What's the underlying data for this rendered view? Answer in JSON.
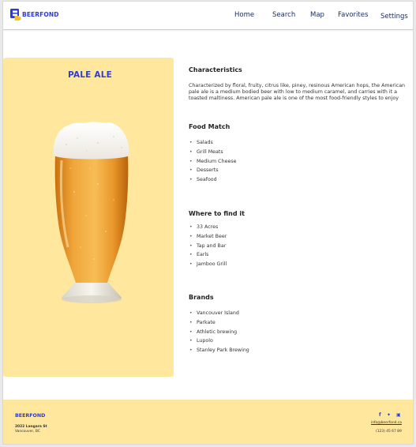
{
  "brand": {
    "name": "BEERFOND",
    "logo_letter": "B",
    "accent_color": "#2b3bd9",
    "card_color": "#ffe79d"
  },
  "nav": {
    "home": "Home",
    "search": "Search",
    "map": "Map",
    "favorites": "Favorites",
    "settings": "Settings"
  },
  "beer": {
    "name": "PALE ALE",
    "image": "beer-glass-icon"
  },
  "sections": {
    "characteristics": {
      "title": "Characteristics",
      "line1": "Characterized by floral, fruity, citrus like, piney, resinous American hops, the American",
      "line2": "pale ale is a medium bodied beer with low to medium caramel, and carries with it a",
      "line3": "toasted maltiness. American pale ale is one of the most food-friendly styles to enjoy"
    },
    "food_match": {
      "title": "Food Match",
      "items": [
        "Salads",
        "Grill Meats",
        "Medium Cheese",
        "Desserts",
        "Seafood"
      ]
    },
    "where": {
      "title": "Where to find it",
      "items": [
        "33 Acres",
        "Market Beer",
        "Tap and Bar",
        "Earls",
        "Jamboo Grill"
      ]
    },
    "brands": {
      "title": "Brands",
      "items": [
        "Vancouver  Island",
        "Parkate",
        "Athletic brewing",
        "Lupolo",
        "Stanley Park Brewing"
      ]
    }
  },
  "footer": {
    "logo": "BEERFOND",
    "street": "2022 Langara St",
    "city": "Vancouver, BC",
    "social": {
      "facebook": "f",
      "twitter": "✦",
      "instagram": "▣"
    },
    "email": "info@beerfond.ca",
    "phone": "(123) 45 67 89"
  }
}
